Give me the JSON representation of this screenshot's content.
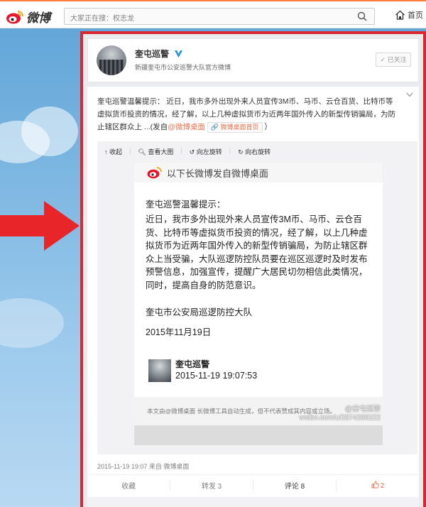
{
  "topbar": {
    "logo_text": "微博",
    "search_placeholder": "大家正在搜：权志龙",
    "home_label": "首页"
  },
  "profile": {
    "name": "奎屯巡警",
    "description": "新疆奎屯市公安巡警大队官方微博",
    "follow_label": "已关注"
  },
  "post": {
    "text_main": "奎屯巡警温馨提示： 近日，我市多外出现外来人员宣传3M币、马币、云仓百货、比特币等虚拟货币投资的情况，经了解，以上几种虚拟货币为近两年国外传入的新型传销骗局，为防止辖区群众上 ...(发自",
    "text_link": "@微博桌面",
    "source_chip": "微博桌面首页",
    "text_end": "）",
    "tools": [
      "收起",
      "查看大图",
      "向左旋转",
      "向右旋转"
    ],
    "longweibo": {
      "header": "以下长微博发自微博桌面",
      "title": "奎屯巡警温馨提示：",
      "paragraph": "近日，我市多外出现外来人员宣传3M币、马币、云仓百货、比特币等虚拟货币投资的情况，经了解，以上几种虚拟货币为近两年国外传入的新型传销骗局，为防止辖区群众上当受骗，大队巡逻防控队员要在巡区巡逻时及时发布预警信息，加强宣传，提醒广大居民切勿相信此类情况，同时，提高自身的防范意识。",
      "signature": "奎屯市公安局巡逻防控大队",
      "date": "2015年11月19日",
      "author": "奎屯巡警",
      "timestamp": "2015-11-19 19:07:53",
      "footer_note": "本文由@微博桌面 长微博工具自动生成，但不代表赞成其内容或立场。",
      "watermark_name": "@奎屯巡警",
      "watermark_url": "weibo.com/u/2874286222"
    },
    "meta": "2015-11-19 19:07 来自 微博桌面",
    "actions": {
      "favorite": "收藏",
      "repost": "转发 3",
      "comment": "评论 8",
      "like": "2"
    }
  },
  "colors": {
    "accent": "#fa7d3c",
    "highlight_border": "#d9282f",
    "arrow": "#e8262a",
    "link": "#eb7350"
  }
}
